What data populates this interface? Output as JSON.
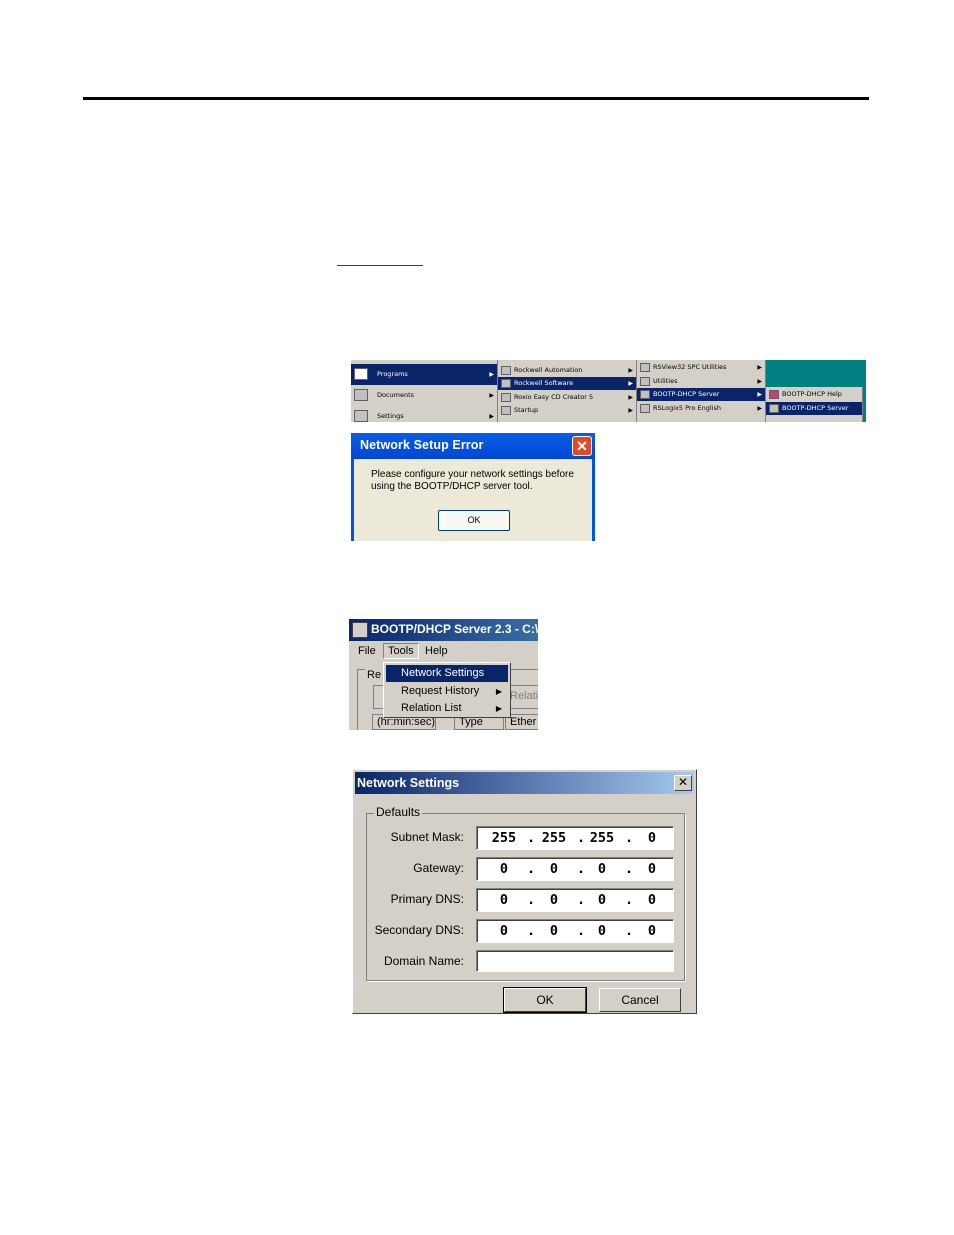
{
  "startmenu": {
    "col1": [
      "Programs",
      "Documents",
      "Settings"
    ],
    "col2": [
      "Rockwell Automation",
      "Rockwell Software",
      "Roxio Easy CD Creator 5",
      "Startup"
    ],
    "col3": [
      "RSView32 SPC Utilities",
      "Utilities",
      "BOOTP-DHCP Server",
      "RSLogix5 Pro English"
    ],
    "col4": [
      "BOOTP-DHCP Help",
      "BOOTP-DHCP Server"
    ]
  },
  "error_dialog": {
    "title": "Network Setup Error",
    "message": "Please configure your network settings before using the BOOTP/DHCP server tool.",
    "ok_label": "OK"
  },
  "bootp_window": {
    "title": "BOOTP/DHCP Server 2.3 - C:\\",
    "menu": [
      "File",
      "Tools",
      "Help"
    ],
    "group_label": "Re",
    "col_headers": [
      "(hr:min:sec)",
      "Type",
      "Ether"
    ],
    "relation_fragment": "Relatio",
    "tools_menu": [
      "Network Settings",
      "Request History",
      "Relation List"
    ]
  },
  "network_settings": {
    "title": "Network Settings",
    "group_label": "Defaults",
    "fields": [
      {
        "label": "Subnet Mask:",
        "octets": [
          "255",
          "255",
          "255",
          "0"
        ]
      },
      {
        "label": "Gateway:",
        "octets": [
          "0",
          "0",
          "0",
          "0"
        ]
      },
      {
        "label": "Primary DNS:",
        "octets": [
          "0",
          "0",
          "0",
          "0"
        ]
      },
      {
        "label": "Secondary DNS:",
        "octets": [
          "0",
          "0",
          "0",
          "0"
        ]
      }
    ],
    "domain_label": "Domain Name:",
    "domain_value": "",
    "ok_label": "OK",
    "cancel_label": "Cancel"
  }
}
